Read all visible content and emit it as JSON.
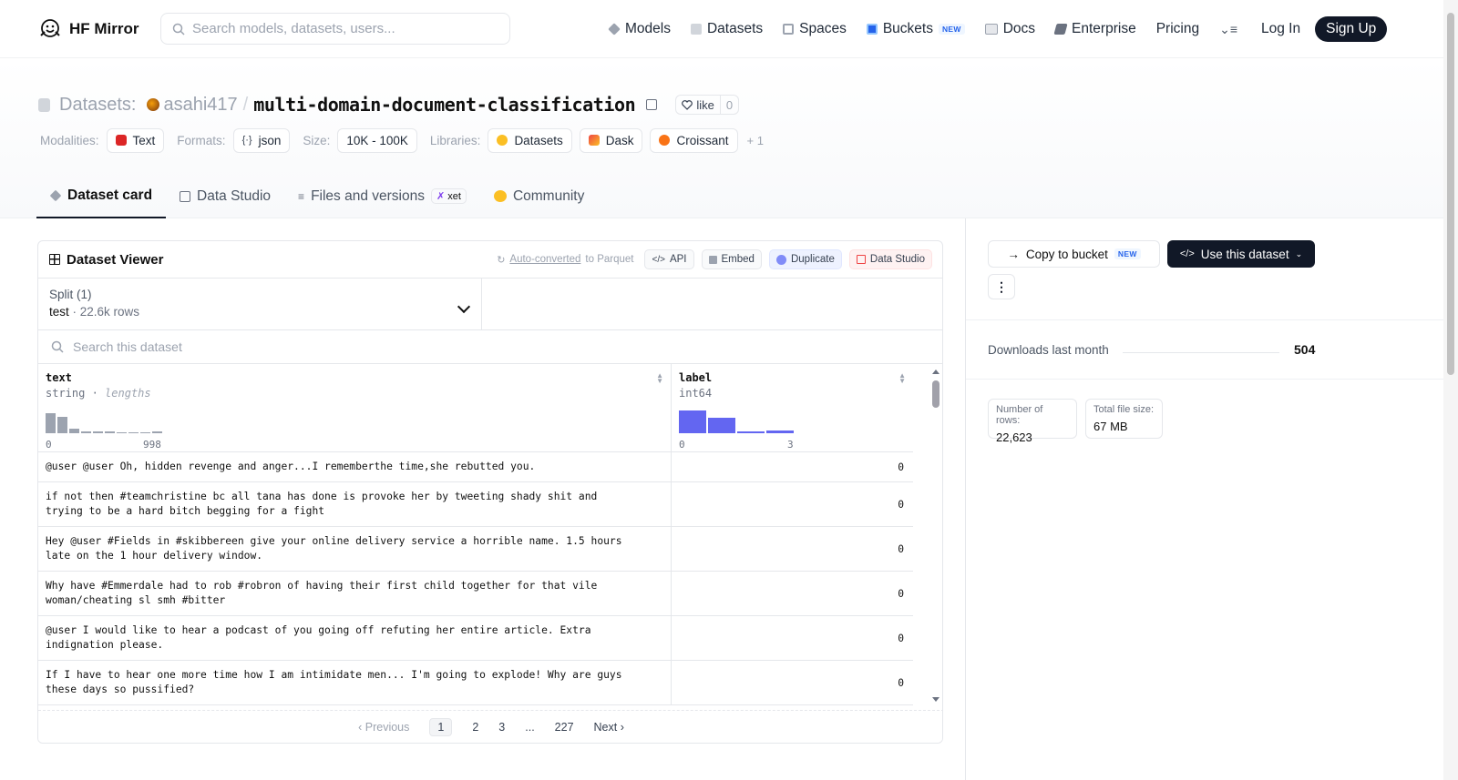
{
  "nav": {
    "brand": "HF Mirror",
    "search_placeholder": "Search models, datasets, users...",
    "links": [
      {
        "label": "Models",
        "icon": "models-icon",
        "color": "#9ca3af"
      },
      {
        "label": "Datasets",
        "icon": "datasets-icon",
        "color": "#d1d5db"
      },
      {
        "label": "Spaces",
        "icon": "spaces-icon",
        "color": "#9ca3af"
      },
      {
        "label": "Buckets",
        "icon": "buckets-icon",
        "color": "#2563eb",
        "badge": "NEW"
      },
      {
        "label": "Docs",
        "icon": "docs-icon",
        "color": "#9ca3af"
      },
      {
        "label": "Enterprise",
        "icon": "enterprise-icon",
        "color": "#6b7280"
      },
      {
        "label": "Pricing"
      }
    ],
    "login": "Log In",
    "signup": "Sign Up"
  },
  "header": {
    "section": "Datasets:",
    "owner": "asahi417",
    "slash": "/",
    "repo": "multi-domain-document-classification",
    "like_label": "like",
    "like_count": "0",
    "meta": {
      "modalities_label": "Modalities:",
      "modality": "Text",
      "formats_label": "Formats:",
      "format": "json",
      "size_label": "Size:",
      "size": "10K - 100K",
      "libraries_label": "Libraries:",
      "libraries": [
        "Datasets",
        "Dask",
        "Croissant"
      ],
      "more": "+ 1"
    }
  },
  "tabs": [
    {
      "label": "Dataset card",
      "active": true
    },
    {
      "label": "Data Studio"
    },
    {
      "label": "Files and versions",
      "badge": "xet"
    },
    {
      "label": "Community"
    }
  ],
  "viewer": {
    "title": "Dataset Viewer",
    "auto_link": "Auto-converted",
    "auto_rest": " to Parquet",
    "actions": [
      "API",
      "Embed",
      "Duplicate",
      "Data Studio"
    ],
    "split_label": "Split (1)",
    "split_name": "test",
    "split_sep": " · ",
    "split_rows": "22.6k rows",
    "search_placeholder": "Search this dataset",
    "columns": [
      {
        "name": "text",
        "type": "string",
        "sub": "lengths",
        "min": "0",
        "max": "998",
        "hist": [
          0.85,
          0.7,
          0.2,
          0.06,
          0.06,
          0.06,
          0,
          0,
          0,
          0.06
        ]
      },
      {
        "name": "label",
        "type": "int64",
        "min": "0",
        "max": "3",
        "hist": [
          0.95,
          0.65,
          0.06,
          0.12
        ]
      }
    ],
    "rows": [
      {
        "text": "@user @user Oh, hidden revenge and anger...I rememberthe time,she rebutted you.",
        "label": "0"
      },
      {
        "text": "if not then #teamchristine bc all tana has done is provoke her by tweeting shady shit and\ntrying to be a hard bitch begging for a fight",
        "label": "0"
      },
      {
        "text": "Hey @user #Fields in #skibbereen give your online delivery service a horrible name. 1.5 hours\nlate on the 1 hour delivery window.",
        "label": "0"
      },
      {
        "text": "Why have #Emmerdale had to rob #robron of having their first child together for that vile\nwoman/cheating sl smh #bitter",
        "label": "0"
      },
      {
        "text": "@user I would like to hear a podcast of you going off refuting her entire article. Extra\nindignation please.",
        "label": "0"
      },
      {
        "text": "If I have to hear one more time how I am intimidate men... I'm going to explode! Why are guys\nthese days so pussified?",
        "label": "0"
      }
    ],
    "pager": {
      "prev": "Previous",
      "pages": [
        "1",
        "2",
        "3",
        "...",
        "227"
      ],
      "next": "Next"
    }
  },
  "sidebar": {
    "copy_bucket": "Copy to bucket",
    "copy_badge": "NEW",
    "use_dataset": "Use this dataset",
    "downloads_label": "Downloads last month",
    "downloads": "504",
    "stats": [
      {
        "label": "Number of rows:",
        "value": "22,623"
      },
      {
        "label": "Total file size:",
        "value": "67 MB"
      }
    ]
  }
}
